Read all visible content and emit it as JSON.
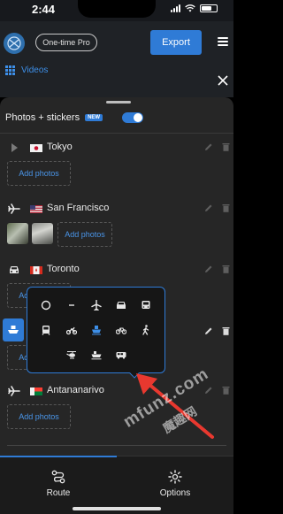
{
  "status_bar": {
    "time": "2:44"
  },
  "header": {
    "pro_label": "One-time Pro",
    "export_label": "Export",
    "videos_label": "Videos"
  },
  "sheet": {
    "title": "Photos + stickers",
    "badge": "NEW",
    "toggle_on": true
  },
  "stops": [
    {
      "city": "Tokyo",
      "flag": "japan-flag-icon",
      "transport": "play-icon",
      "add_photos": "Add photos"
    },
    {
      "city": "San Francisco",
      "flag": "usa-flag-icon",
      "transport": "airplane-icon",
      "add_photos": "Add photos"
    },
    {
      "city": "Toronto",
      "flag": "canada-flag-icon",
      "transport": "car-icon",
      "add_photos": "Add photos"
    },
    {
      "city": "",
      "flag": "",
      "transport": "boat-icon",
      "add_photos": "Add photos"
    },
    {
      "city": "Antananarivo",
      "flag": "madagascar-flag-icon",
      "transport": "airplane-icon",
      "add_photos": "Add photos"
    }
  ],
  "transport_options": [
    "circle-icon",
    "dash-icon",
    "airplane-icon",
    "car-icon",
    "bus-icon",
    "train-icon",
    "motorcycle-icon",
    "boat-icon",
    "bicycle-icon",
    "walking-icon",
    "helicopter-icon",
    "ship-icon",
    "rv-icon"
  ],
  "selected_transport": "boat-icon",
  "tabs": [
    {
      "label": "Route",
      "icon": "route-icon",
      "active": true
    },
    {
      "label": "Options",
      "icon": "gear-icon",
      "active": false
    }
  ],
  "watermark": "mfunz.com",
  "watermark_cjk": "魔趣网",
  "colors": {
    "accent": "#2f7bd6",
    "arrow": "#e8382f"
  }
}
